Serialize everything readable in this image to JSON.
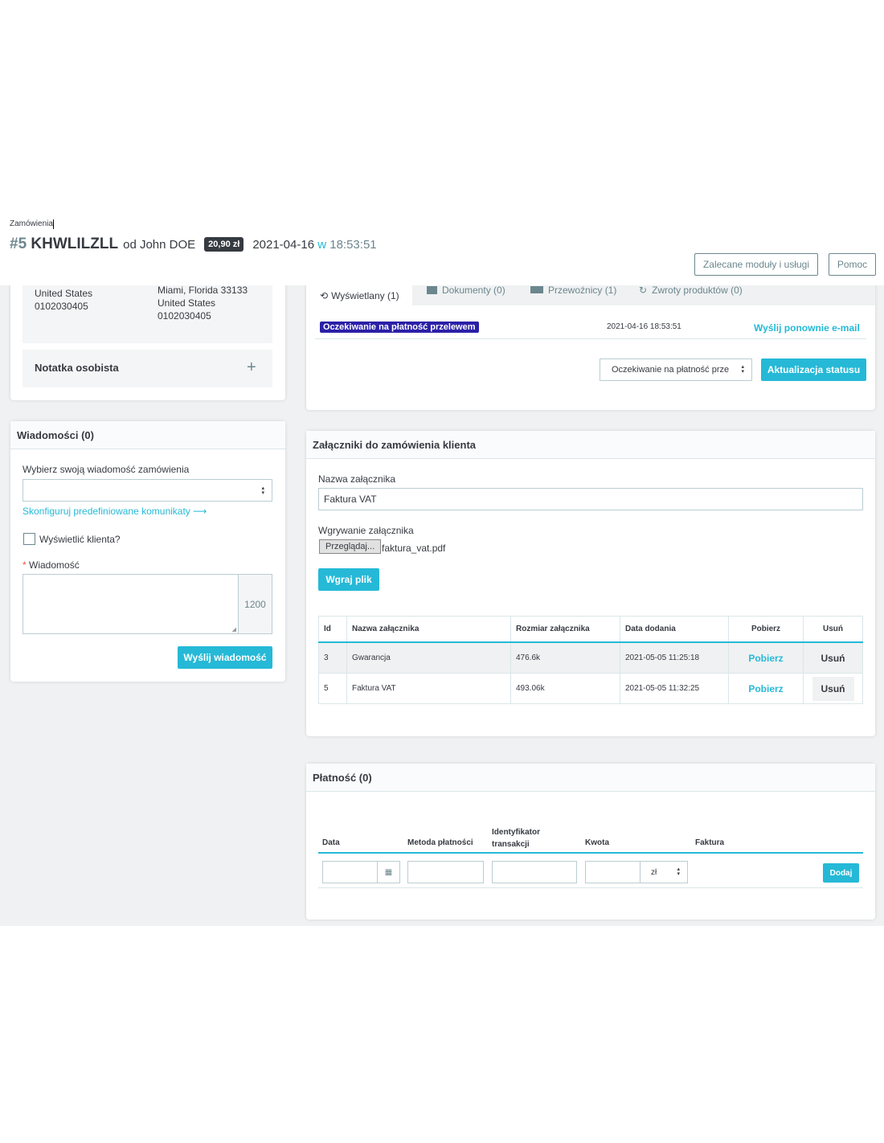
{
  "header": {
    "breadcrumb": "Zamówienia",
    "order_number": "#5",
    "order_ref": "KHWLILZLL",
    "from_text": "od John DOE",
    "total": "20,90 zł",
    "date": "2021-04-16",
    "date_sep": "w",
    "time": "18:53:51",
    "recommended_label": "Zalecane moduły i usługi",
    "help_label": "Pomoc"
  },
  "address": {
    "left_country": "United States",
    "left_phone": "0102030405",
    "right_city": "Miami, Florida 33133",
    "right_country": "United States",
    "right_phone": "0102030405"
  },
  "personal_note": {
    "label": "Notatka osobista",
    "add_symbol": "+"
  },
  "messages": {
    "title": "Wiadomości (0)",
    "select_label": "Wybierz swoją wiadomość zamówienia",
    "configure_link": "Skonfiguruj predefiniowane komunikaty",
    "configure_arrow": "⟶",
    "display_customer_label": "Wyświetlić klienta?",
    "required_mark": "*",
    "message_label": "Wiadomość",
    "char_counter": "1200",
    "send_label": "Wyślij wiadomość"
  },
  "status": {
    "tabs": [
      {
        "label": "Wyświetlany (1)"
      },
      {
        "label": "Dokumenty (0)"
      },
      {
        "label": "Przewoźnicy (1)"
      },
      {
        "label": "Zwroty produktów (0)"
      }
    ],
    "current_status": "Oczekiwanie na płatność przelewem",
    "status_date": "2021-04-16 18:53:51",
    "resend_label": "Wyślij ponownie e-mail",
    "select_value": "Oczekiwanie na płatność prze",
    "update_label": "Aktualizacja statusu",
    "status_color": "#2b20a8"
  },
  "attachments": {
    "title": "Załączniki do zamówienia klienta",
    "name_label": "Nazwa załącznika",
    "name_value": "Faktura VAT",
    "upload_label": "Wgrywanie załącznika",
    "browse_label": "Przeglądaj...",
    "file_name": "faktura_vat.pdf",
    "upload_button": "Wgraj plik",
    "columns": [
      "Id",
      "Nazwa załącznika",
      "Rozmiar załącznika",
      "Data dodania",
      "Pobierz",
      "Usuń"
    ],
    "rows": [
      {
        "id": "3",
        "name": "Gwarancja",
        "size": "476.6k",
        "date": "2021-05-05 11:25:18",
        "download": "Pobierz",
        "delete": "Usuń"
      },
      {
        "id": "5",
        "name": "Faktura VAT",
        "size": "493.06k",
        "date": "2021-05-05 11:32:25",
        "download": "Pobierz",
        "delete": "Usuń"
      }
    ]
  },
  "payment": {
    "title": "Płatność (0)",
    "col_date": "Data",
    "col_method": "Metoda płatności",
    "col_transaction_1": "Identyfikator",
    "col_transaction_2": "transakcji",
    "col_amount": "Kwota",
    "col_invoice": "Faktura",
    "currency": "zł",
    "add_label": "Dodaj"
  },
  "colors": {
    "accent": "#25b9d7",
    "background": "#eff1f2",
    "text": "#363a41"
  }
}
